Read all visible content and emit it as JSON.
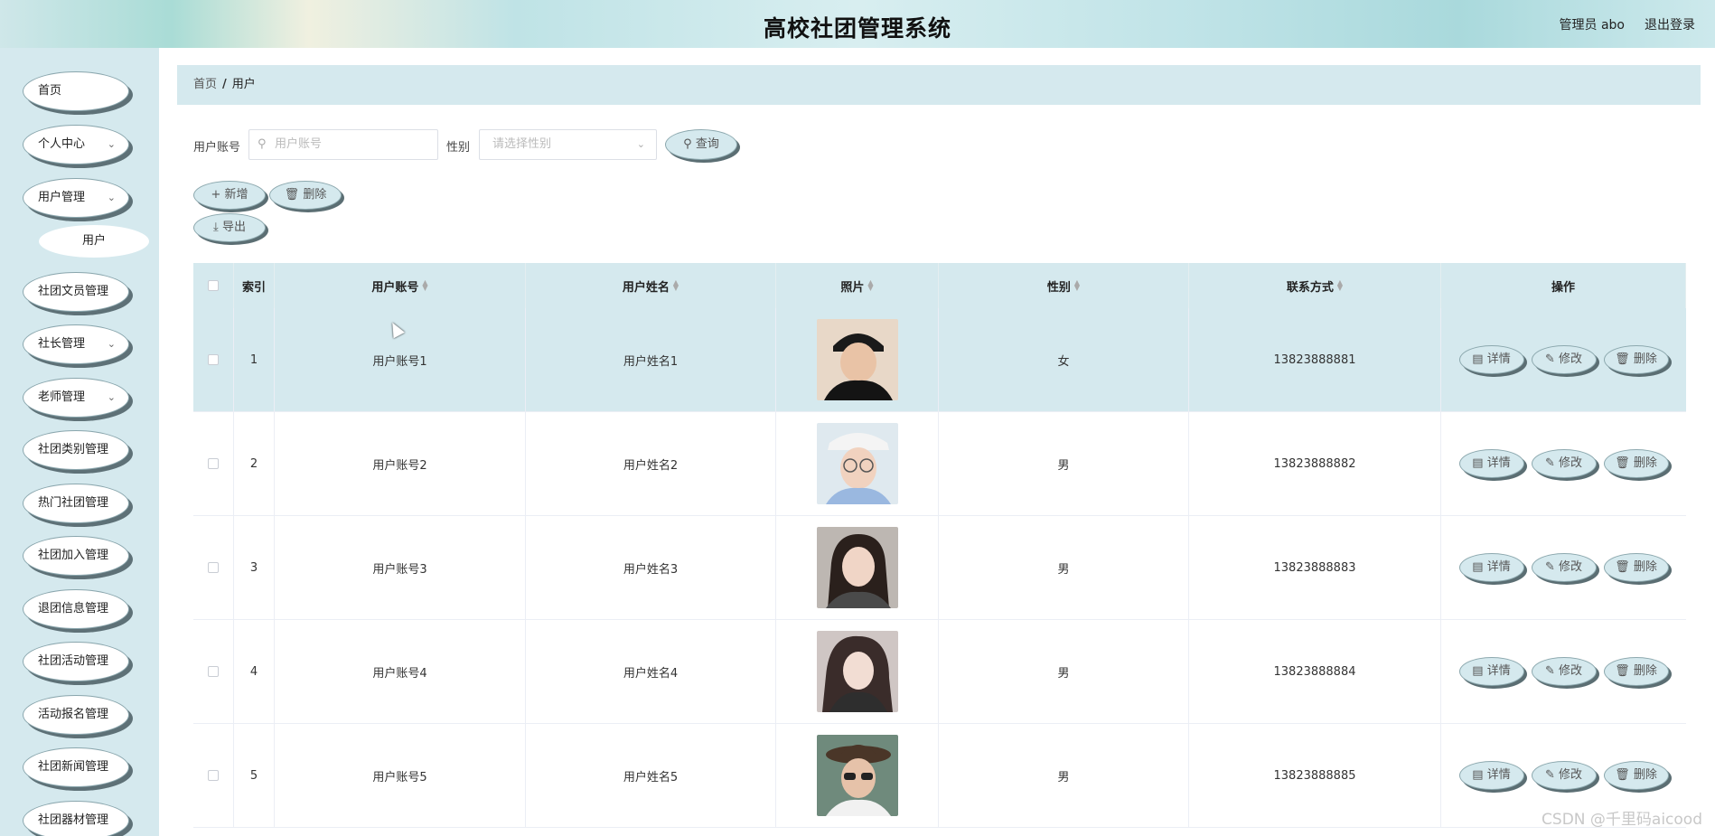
{
  "header": {
    "title": "高校社团管理系统",
    "admin": "管理员 abo",
    "logout": "退出登录"
  },
  "sidebar": {
    "items": [
      {
        "label": "首页",
        "has_children": false
      },
      {
        "label": "个人中心",
        "has_children": true
      },
      {
        "label": "用户管理",
        "has_children": true
      },
      {
        "label": "社团文员管理",
        "has_children": true
      },
      {
        "label": "社长管理",
        "has_children": true
      },
      {
        "label": "老师管理",
        "has_children": true
      },
      {
        "label": "社团类别管理",
        "has_children": true
      },
      {
        "label": "热门社团管理",
        "has_children": true
      },
      {
        "label": "社团加入管理",
        "has_children": true
      },
      {
        "label": "退团信息管理",
        "has_children": true
      },
      {
        "label": "社团活动管理",
        "has_children": true
      },
      {
        "label": "活动报名管理",
        "has_children": true
      },
      {
        "label": "社团新闻管理",
        "has_children": true
      },
      {
        "label": "社团器材管理",
        "has_children": true
      }
    ],
    "sub_item": "用户"
  },
  "breadcrumb": {
    "home": "首页",
    "separator": "/",
    "current": "用户"
  },
  "search": {
    "account_label": "用户账号",
    "account_placeholder": "用户账号",
    "gender_label": "性别",
    "gender_placeholder": "请选择性别",
    "query_button": "查询"
  },
  "actions": {
    "add": "新增",
    "delete": "删除",
    "export": "导出"
  },
  "table": {
    "headers": [
      "索引",
      "用户账号",
      "用户姓名",
      "照片",
      "性别",
      "联系方式",
      "操作"
    ],
    "rows": [
      {
        "index": "1",
        "account": "用户账号1",
        "name": "用户姓名1",
        "gender": "女",
        "phone": "13823888881"
      },
      {
        "index": "2",
        "account": "用户账号2",
        "name": "用户姓名2",
        "gender": "男",
        "phone": "13823888882"
      },
      {
        "index": "3",
        "account": "用户账号3",
        "name": "用户姓名3",
        "gender": "男",
        "phone": "13823888883"
      },
      {
        "index": "4",
        "account": "用户账号4",
        "name": "用户姓名4",
        "gender": "男",
        "phone": "13823888884"
      },
      {
        "index": "5",
        "account": "用户账号5",
        "name": "用户姓名5",
        "gender": "男",
        "phone": "13823888885"
      }
    ],
    "row_ops": {
      "detail": "详情",
      "edit": "修改",
      "delete": "删除"
    }
  },
  "watermark": "CSDN @千里码aicood",
  "colors": {
    "accent_bg": "#d5e9ee",
    "pill_shadow": "#5b6e73"
  }
}
